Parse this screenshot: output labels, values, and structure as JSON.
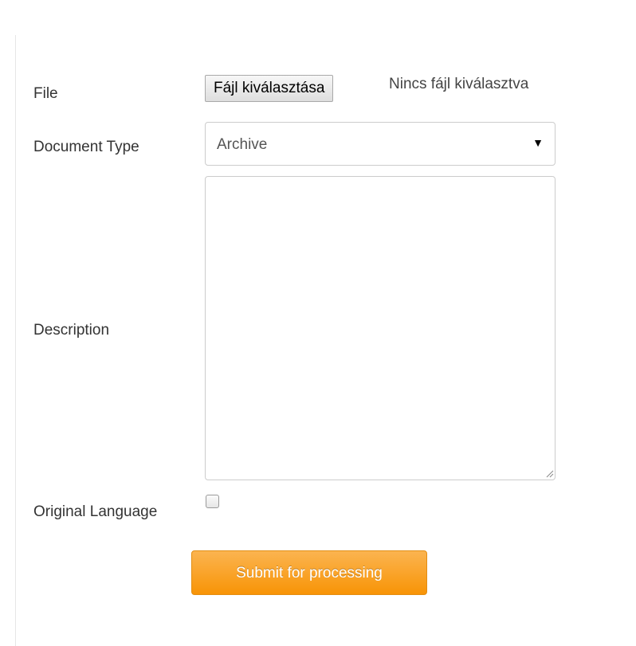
{
  "form": {
    "file": {
      "label": "File",
      "button_label": "Fájl kiválasztása",
      "status_text": "Nincs fájl kiválasztva"
    },
    "document_type": {
      "label": "Document Type",
      "selected_value": "Archive",
      "arrow_icon": "▼"
    },
    "description": {
      "label": "Description",
      "value": ""
    },
    "original_language": {
      "label": "Original Language",
      "checked": false
    },
    "submit": {
      "label": "Submit for processing"
    }
  },
  "colors": {
    "submit_bg": "#f89406",
    "label_text": "#333333",
    "border": "#cccccc"
  }
}
